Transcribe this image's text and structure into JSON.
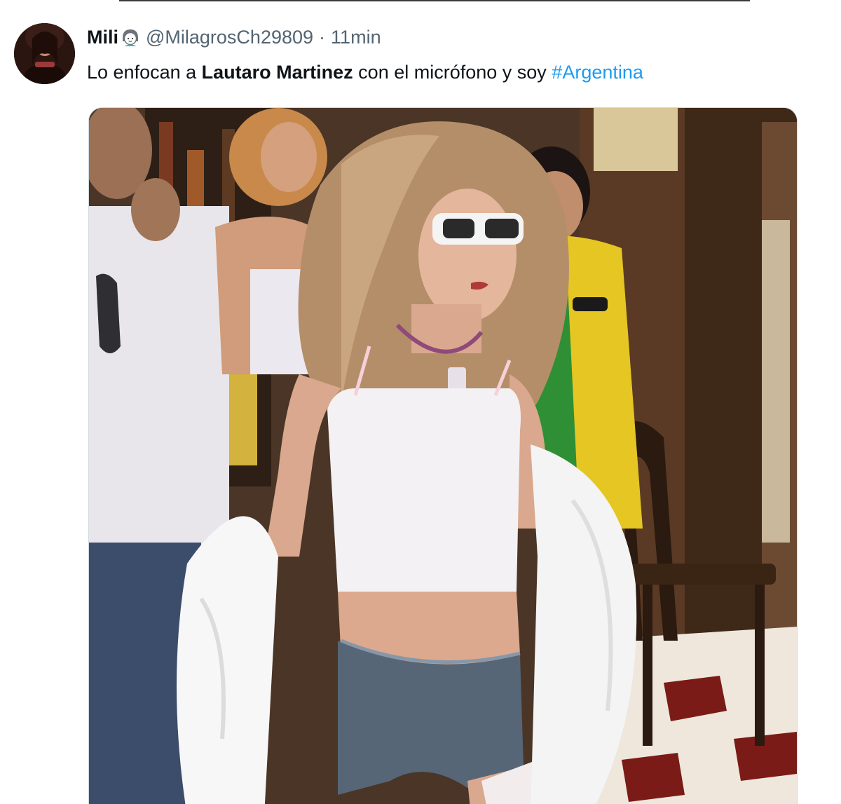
{
  "tweet": {
    "author": {
      "display_name": "Mili",
      "emoji_icon": "woman-face-emoji-icon",
      "handle": "@MilagrosCh29809"
    },
    "separator": "·",
    "time_ago": "11min",
    "text": {
      "before": "Lo enfocan a ",
      "mention": "Lautaro Martinez",
      "middle": " con el micrófono y soy ",
      "hashtag": "#Argentina"
    }
  },
  "colors": {
    "name": "#0f1419",
    "handle": "#536471",
    "hashtag": "#1d9bf0"
  }
}
